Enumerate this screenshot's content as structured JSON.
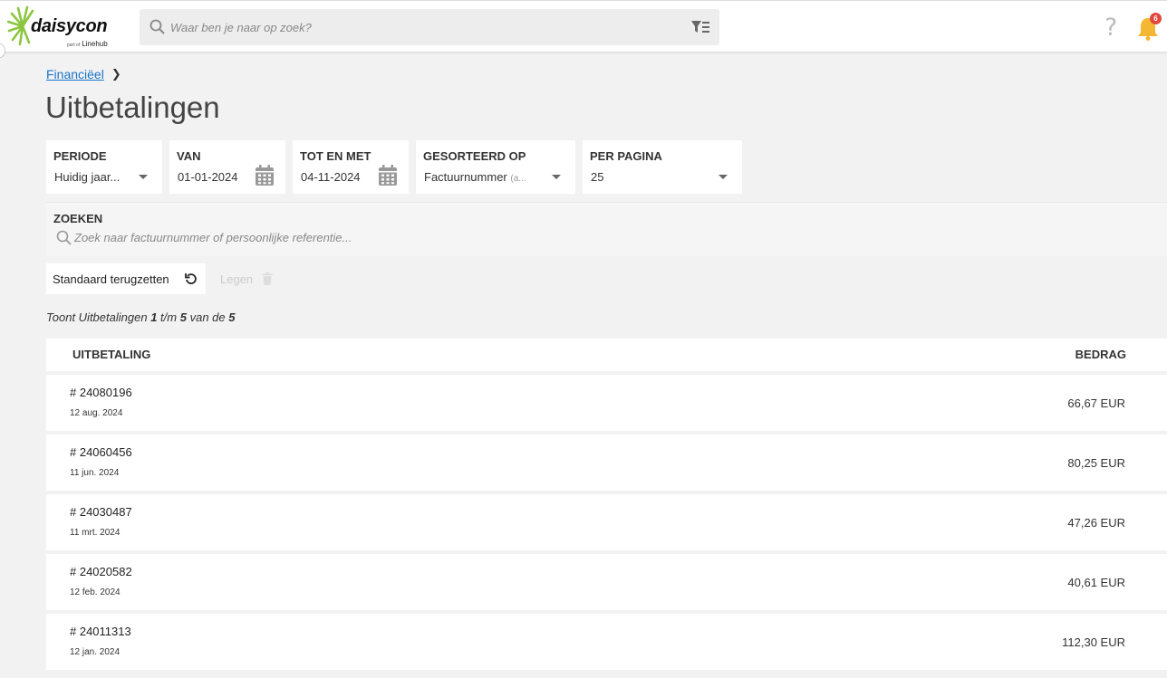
{
  "brand": {
    "name": "daisycon",
    "sub_prefix": "part of",
    "sub_name": "Linehub",
    "accent": "#8cc63f"
  },
  "header": {
    "search_placeholder": "Waar ben je naar op zoek?",
    "notification_count": "6",
    "help_symbol": "?"
  },
  "breadcrumb": {
    "parent": "Financiëel"
  },
  "page": {
    "title": "Uitbetalingen"
  },
  "filters": {
    "periode": {
      "label": "PERIODE",
      "value": "Huidig jaar..."
    },
    "van": {
      "label": "VAN",
      "value": "01-01-2024"
    },
    "tot_en_met": {
      "label": "TOT EN MET",
      "value": "04-11-2024"
    },
    "gesorteerd_op": {
      "label": "GESORTEERD OP",
      "value": "Factuurnummer",
      "suffix": "(a..."
    },
    "per_pagina": {
      "label": "PER PAGINA",
      "value": "25"
    }
  },
  "search": {
    "label": "ZOEKEN",
    "placeholder": "Zoek naar factuurnummer of persoonlijke referentie..."
  },
  "actions": {
    "reset_label": "Standaard terugzetten",
    "clear_label": "Legen"
  },
  "results": {
    "prefix": "Toont Uitbetalingen",
    "from": "1",
    "sep": "t/m",
    "to": "5",
    "of": "van de",
    "total": "5"
  },
  "table": {
    "col_payout": "UITBETALING",
    "col_amount": "BEDRAG",
    "rows": [
      {
        "number": "# 24080196",
        "date": "12 aug. 2024",
        "amount": "66,67 EUR"
      },
      {
        "number": "# 24060456",
        "date": "11 jun. 2024",
        "amount": "80,25 EUR"
      },
      {
        "number": "# 24030487",
        "date": "11 mrt. 2024",
        "amount": "47,26 EUR"
      },
      {
        "number": "# 24020582",
        "date": "12 feb. 2024",
        "amount": "40,61 EUR"
      },
      {
        "number": "# 24011313",
        "date": "12 jan. 2024",
        "amount": "112,30 EUR"
      }
    ]
  }
}
